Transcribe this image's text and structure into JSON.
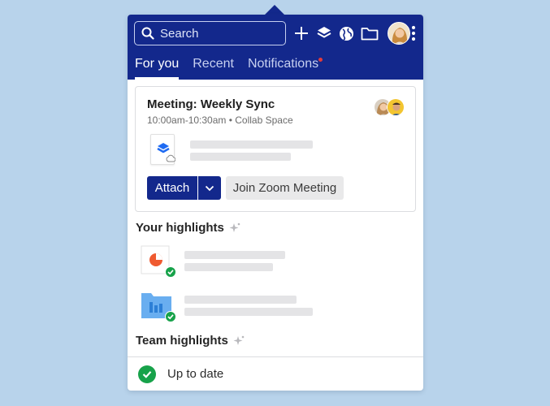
{
  "header": {
    "search": {
      "placeholder": "Search"
    },
    "icons": [
      "search-icon",
      "plus-icon",
      "dropbox-icon",
      "globe-icon",
      "folder-icon",
      "avatar",
      "more-vertical-icon"
    ],
    "tabs": [
      {
        "label": "For you",
        "active": true
      },
      {
        "label": "Recent",
        "active": false
      },
      {
        "label": "Notifications",
        "active": false,
        "has_unread": true
      }
    ]
  },
  "meeting": {
    "title": "Meeting: Weekly Sync",
    "subtitle": "10:00am-10:30am • Collab Space",
    "attach_label": "Attach",
    "join_label": "Join Zoom Meeting"
  },
  "highlights": {
    "your_title": "Your highlights",
    "team_title": "Team highlights"
  },
  "footer": {
    "status": "Up to date"
  },
  "colors": {
    "brand_navy": "#13288c",
    "background": "#b8d3eb",
    "success_green": "#17a24a",
    "notification_red": "#e23b3b"
  }
}
